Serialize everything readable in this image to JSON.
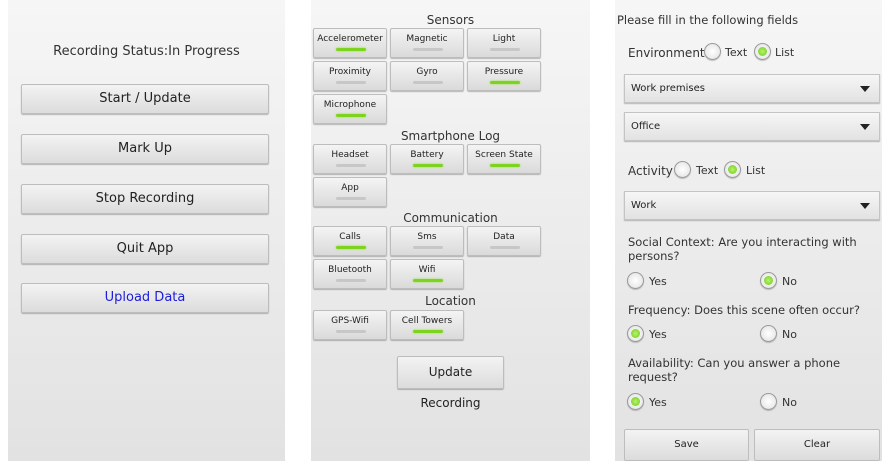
{
  "recording": {
    "status": "Recording Status:In Progress",
    "buttons": [
      "Start / Update",
      "Mark Up",
      "Stop Recording",
      "Quit App",
      "Upload Data"
    ]
  },
  "sensors_screen": {
    "sections": {
      "sensors": "Sensors",
      "smartphone_log": "Smartphone Log",
      "communication": "Communication",
      "location": "Location"
    },
    "toggles": {
      "accelerometer": {
        "label": "Accelerometer",
        "on": true
      },
      "magnetic": {
        "label": "Magnetic",
        "on": false
      },
      "light": {
        "label": "Light",
        "on": false
      },
      "proximity": {
        "label": "Proximity",
        "on": false
      },
      "gyro": {
        "label": "Gyro",
        "on": false
      },
      "pressure": {
        "label": "Pressure",
        "on": true
      },
      "microphone": {
        "label": "Microphone",
        "on": true
      },
      "headset": {
        "label": "Headset",
        "on": false
      },
      "battery": {
        "label": "Battery",
        "on": true
      },
      "screen_state": {
        "label": "Screen State",
        "on": true
      },
      "app": {
        "label": "App",
        "on": false
      },
      "calls": {
        "label": "Calls",
        "on": true
      },
      "sms": {
        "label": "Sms",
        "on": false
      },
      "data": {
        "label": "Data",
        "on": false
      },
      "bluetooth": {
        "label": "Bluetooth",
        "on": false
      },
      "wifi": {
        "label": "Wifi",
        "on": true
      },
      "gps_wifi": {
        "label": "GPS-Wifi",
        "on": false
      },
      "cell_towers": {
        "label": "Cell Towers",
        "on": true
      }
    },
    "update_button": "Update Recording"
  },
  "form": {
    "heading": "Please fill in the following fields",
    "environment_label": "Environment",
    "activity_label": "Activity",
    "text_option": "Text",
    "list_option": "List",
    "environment_dropdown": "Work premises",
    "location_dropdown": "Office",
    "activity_dropdown": "Work",
    "social_question": "Social Context: Are you interacting with persons?",
    "frequency_question": "Frequency: Does this scene often occur?",
    "availability_question": "Availability: Can you answer a phone request?",
    "yes": "Yes",
    "no": "No",
    "save": "Save",
    "clear": "Clear"
  },
  "colors": {
    "toggle_on": "#7ed321",
    "upload_text": "#1d1ddb"
  }
}
